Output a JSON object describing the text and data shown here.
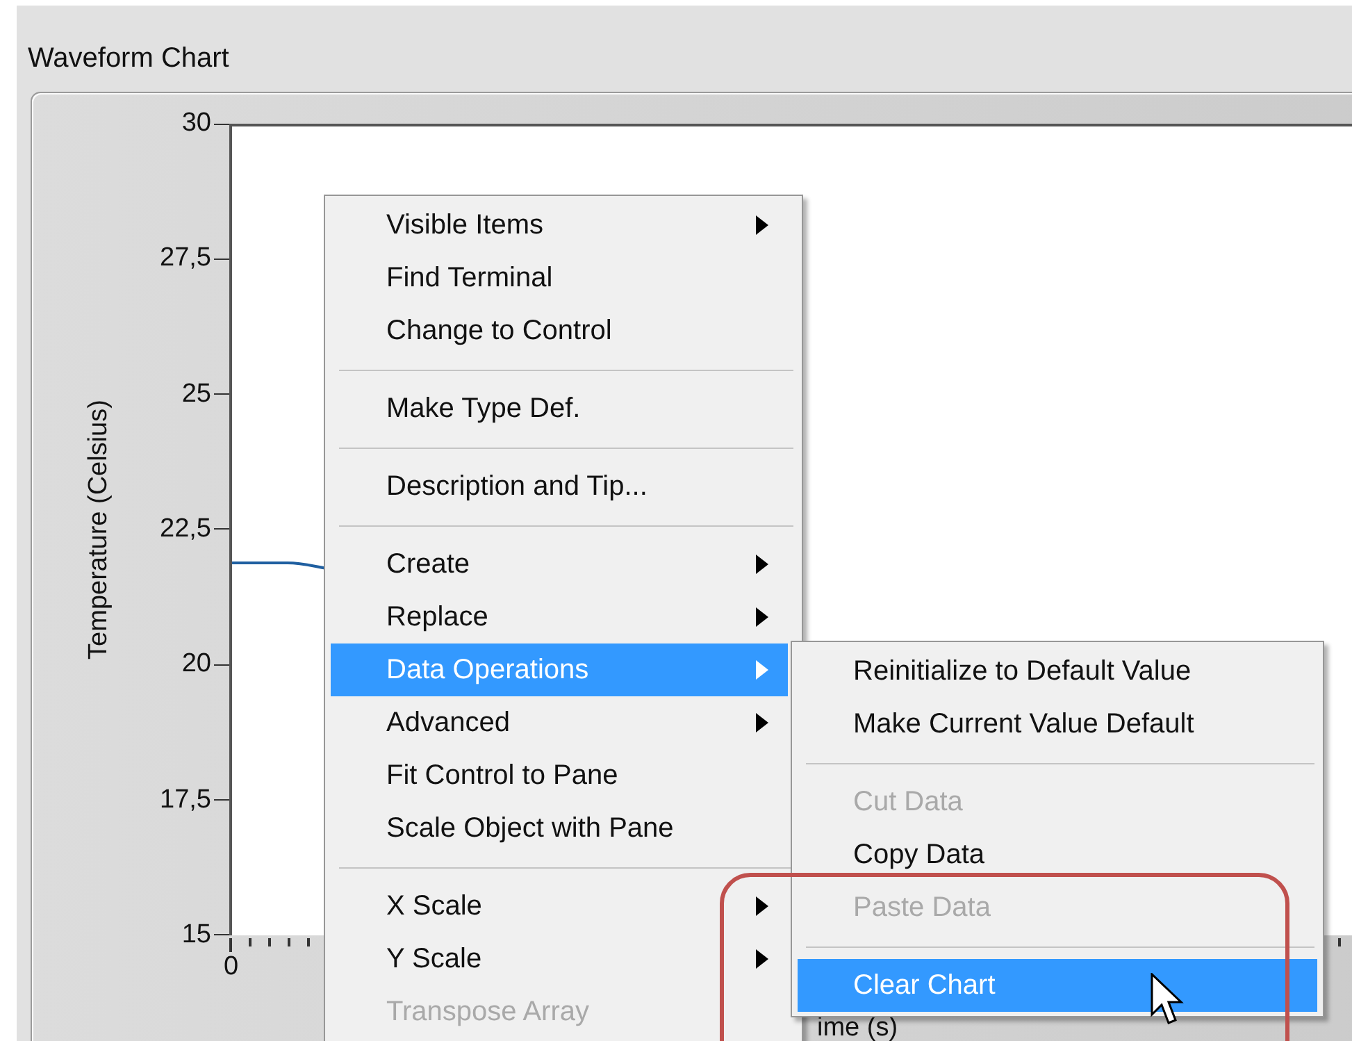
{
  "chart": {
    "title": "Waveform Chart",
    "ylabel": "Temperature (Celsius)",
    "yticks": [
      "30",
      "27,5",
      "25",
      "22,5",
      "20",
      "17,5",
      "15"
    ],
    "xticks": [
      "0"
    ],
    "xlabel": "ime (s)"
  },
  "context_menu": {
    "items": [
      {
        "kind": "item",
        "label": "Visible Items",
        "submenu": true,
        "disabled": false,
        "selected": false
      },
      {
        "kind": "item",
        "label": "Find Terminal",
        "submenu": false,
        "disabled": false,
        "selected": false
      },
      {
        "kind": "item",
        "label": "Change to Control",
        "submenu": false,
        "disabled": false,
        "selected": false
      },
      {
        "kind": "separator"
      },
      {
        "kind": "item",
        "label": "Make Type Def.",
        "submenu": false,
        "disabled": false,
        "selected": false
      },
      {
        "kind": "separator"
      },
      {
        "kind": "item",
        "label": "Description and Tip...",
        "submenu": false,
        "disabled": false,
        "selected": false
      },
      {
        "kind": "separator"
      },
      {
        "kind": "item",
        "label": "Create",
        "submenu": true,
        "disabled": false,
        "selected": false
      },
      {
        "kind": "item",
        "label": "Replace",
        "submenu": true,
        "disabled": false,
        "selected": false
      },
      {
        "kind": "item",
        "label": "Data Operations",
        "submenu": true,
        "disabled": false,
        "selected": true
      },
      {
        "kind": "item",
        "label": "Advanced",
        "submenu": true,
        "disabled": false,
        "selected": false
      },
      {
        "kind": "item",
        "label": "Fit Control to Pane",
        "submenu": false,
        "disabled": false,
        "selected": false
      },
      {
        "kind": "item",
        "label": "Scale Object with Pane",
        "submenu": false,
        "disabled": false,
        "selected": false
      },
      {
        "kind": "separator"
      },
      {
        "kind": "item",
        "label": "X Scale",
        "submenu": true,
        "disabled": false,
        "selected": false
      },
      {
        "kind": "item",
        "label": "Y Scale",
        "submenu": true,
        "disabled": false,
        "selected": false
      },
      {
        "kind": "item",
        "label": "Transpose Array",
        "submenu": false,
        "disabled": true,
        "selected": false
      }
    ]
  },
  "submenu": {
    "items": [
      {
        "kind": "item",
        "label": "Reinitialize to Default Value",
        "disabled": false,
        "selected": false
      },
      {
        "kind": "item",
        "label": "Make Current Value Default",
        "disabled": false,
        "selected": false
      },
      {
        "kind": "separator"
      },
      {
        "kind": "item",
        "label": "Cut Data",
        "disabled": true,
        "selected": false
      },
      {
        "kind": "item",
        "label": "Copy Data",
        "disabled": false,
        "selected": false
      },
      {
        "kind": "item",
        "label": "Paste Data",
        "disabled": true,
        "selected": false
      },
      {
        "kind": "separator"
      },
      {
        "kind": "item",
        "label": "Clear Chart",
        "disabled": false,
        "selected": true
      }
    ]
  }
}
